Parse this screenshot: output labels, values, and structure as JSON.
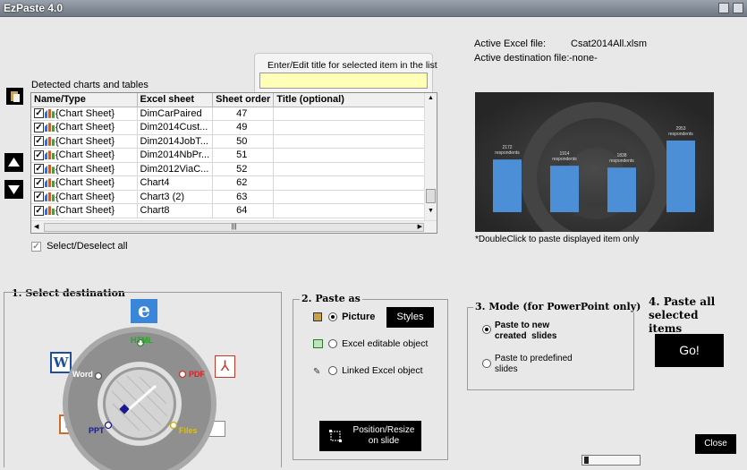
{
  "window": {
    "title": "EzPaste 4.0"
  },
  "title_edit": {
    "label": "Enter/Edit title for selected item in the list",
    "value": ""
  },
  "info": {
    "active_excel_label": "Active Excel file:",
    "active_excel_value": "Csat2014All.xlsm",
    "active_dest_label": "Active destination file:",
    "active_dest_value": "-none-"
  },
  "list": {
    "label": "Detected charts and tables",
    "columns": [
      "Name/Type",
      "Excel sheet",
      "Sheet order",
      "Title (optional)"
    ],
    "rows": [
      {
        "name": "{Chart Sheet}",
        "sheet": "DimCarPaired",
        "order": "47",
        "title": ""
      },
      {
        "name": "{Chart Sheet}",
        "sheet": "Dim2014Cust...",
        "order": "49",
        "title": ""
      },
      {
        "name": "{Chart Sheet}",
        "sheet": "Dim2014JobT...",
        "order": "50",
        "title": ""
      },
      {
        "name": "{Chart Sheet}",
        "sheet": "Dim2014NbPr...",
        "order": "51",
        "title": ""
      },
      {
        "name": "{Chart Sheet}",
        "sheet": "Dim2012ViaC...",
        "order": "52",
        "title": ""
      },
      {
        "name": "{Chart Sheet}",
        "sheet": "Chart4",
        "order": "62",
        "title": ""
      },
      {
        "name": "{Chart Sheet}",
        "sheet": "Chart3 (2)",
        "order": "63",
        "title": ""
      },
      {
        "name": "{Chart Sheet}",
        "sheet": "Chart8",
        "order": "64",
        "title": ""
      }
    ],
    "select_all_label": "Select/Deselect all"
  },
  "preview": {
    "note": "*DoubleClick to paste displayed item only",
    "bars": [
      {
        "label": "2172\nrespondents",
        "value": 2172
      },
      {
        "label": "1914\nrespondents",
        "value": 1914
      },
      {
        "label": "1838\nrespondents",
        "value": 1838
      },
      {
        "label": "2953\nrespondents",
        "value": 2953
      }
    ]
  },
  "destination": {
    "title": "1. Select destination",
    "options": {
      "html": "HTML",
      "word": "Word",
      "pdf": "PDF",
      "ppt": "PPT",
      "files": "Files"
    }
  },
  "paste_as": {
    "title": "2. Paste as",
    "picture": "Picture",
    "styles": "Styles",
    "excel_editable": "Excel editable object",
    "linked": "Linked Excel object",
    "position_resize": "Position/Resize\non slide"
  },
  "mode": {
    "title": "3. Mode (for PowerPoint only)",
    "new_slides": "Paste to new\ncreated  slides",
    "predefined": "Paste to predefined\nslides"
  },
  "paste_all": {
    "title": "4. Paste all\nselected items",
    "go": "Go!"
  },
  "close": "Close"
}
